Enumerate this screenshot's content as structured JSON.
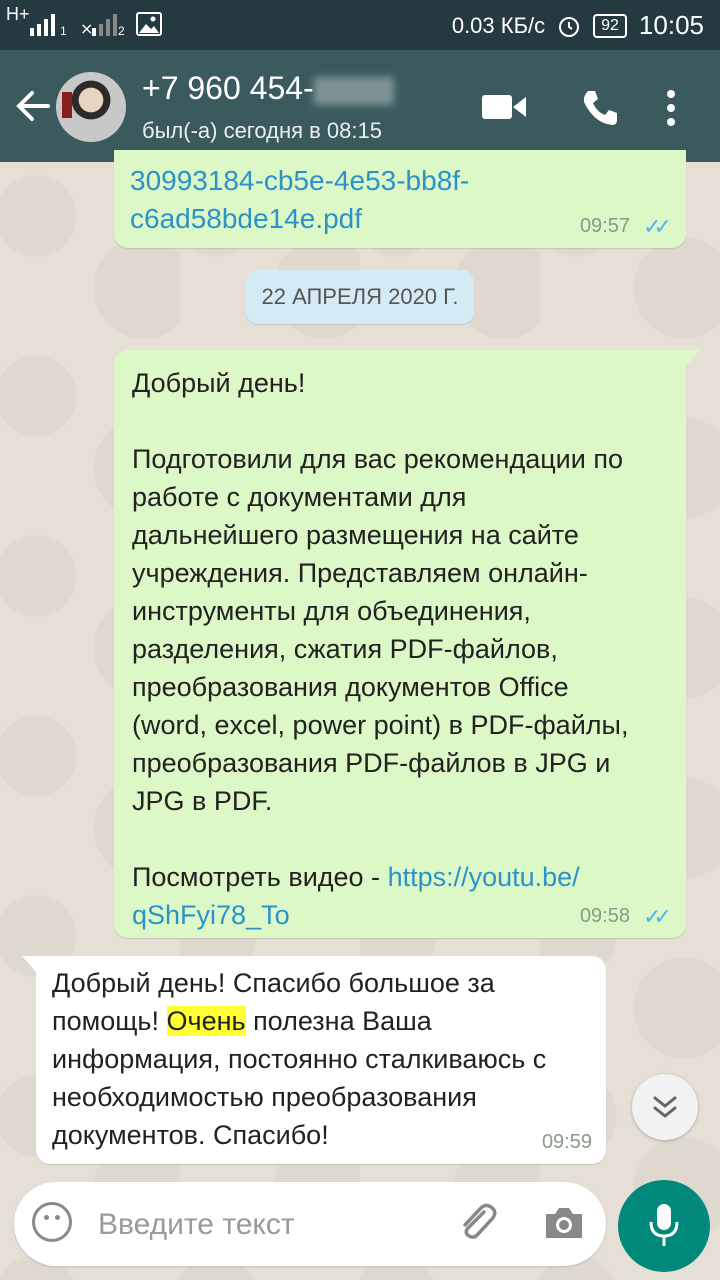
{
  "status_bar": {
    "network": "H+",
    "sim1": "1",
    "sim2": "2",
    "speed": "0.03 КБ/с",
    "battery": "92",
    "time": "10:05"
  },
  "header": {
    "phone_visible": "+7 960 454-",
    "last_seen": "был(-а) сегодня в 08:15",
    "icons": [
      "back-arrow-icon",
      "video-call-icon",
      "phone-call-icon",
      "more-vert-icon"
    ]
  },
  "messages": {
    "m1": {
      "file_line1": "30993184-cb5e-4e53-bb8f-",
      "file_line2": "c6ad58bde14e.pdf",
      "time": "09:57",
      "ticks": "✓✓"
    },
    "date_chip": "22 АПРЕЛЯ 2020 Г.",
    "m2": {
      "greeting": "Добрый день!",
      "lines": [
        "Подготовили для вас рекомендации по",
        "работе с документами для",
        "дальнейшего размещения на сайте",
        "учреждения. Представляем онлайн-",
        "инструменты для объединения,",
        "разделения, сжатия PDF-файлов,",
        "преобразования документов Office",
        "(word, excel, power point) в PDF-файлы,",
        "преобразования PDF-файлов в JPG и",
        "JPG в PDF."
      ],
      "video_label": "Посмотреть видео - ",
      "link_line1": "https://youtu.be/",
      "link_line2": "qShFyi78_To",
      "time": "09:58",
      "ticks": "✓✓"
    },
    "m3": {
      "line1": "Добрый день! Спасибо большое за",
      "line2_pre": "помощь! ",
      "line2_hl": "Очень",
      "line2_post": " полезна Ваша",
      "line3": "информация, постоянно сталкиваюсь с",
      "line4": "необходимостью преобразования",
      "line5": "документов. Спасибо!",
      "time": "09:59"
    }
  },
  "input": {
    "placeholder": "Введите текст"
  },
  "colors": {
    "app_bar": "#3a5a5e",
    "status_bar": "#253a40",
    "outgoing_bubble": "#dcf8c6",
    "incoming_bubble": "#ffffff",
    "link": "#2b93c9",
    "read_ticks": "#4fb6ec",
    "mic_button": "#00897b",
    "highlight": "#ffff33"
  }
}
